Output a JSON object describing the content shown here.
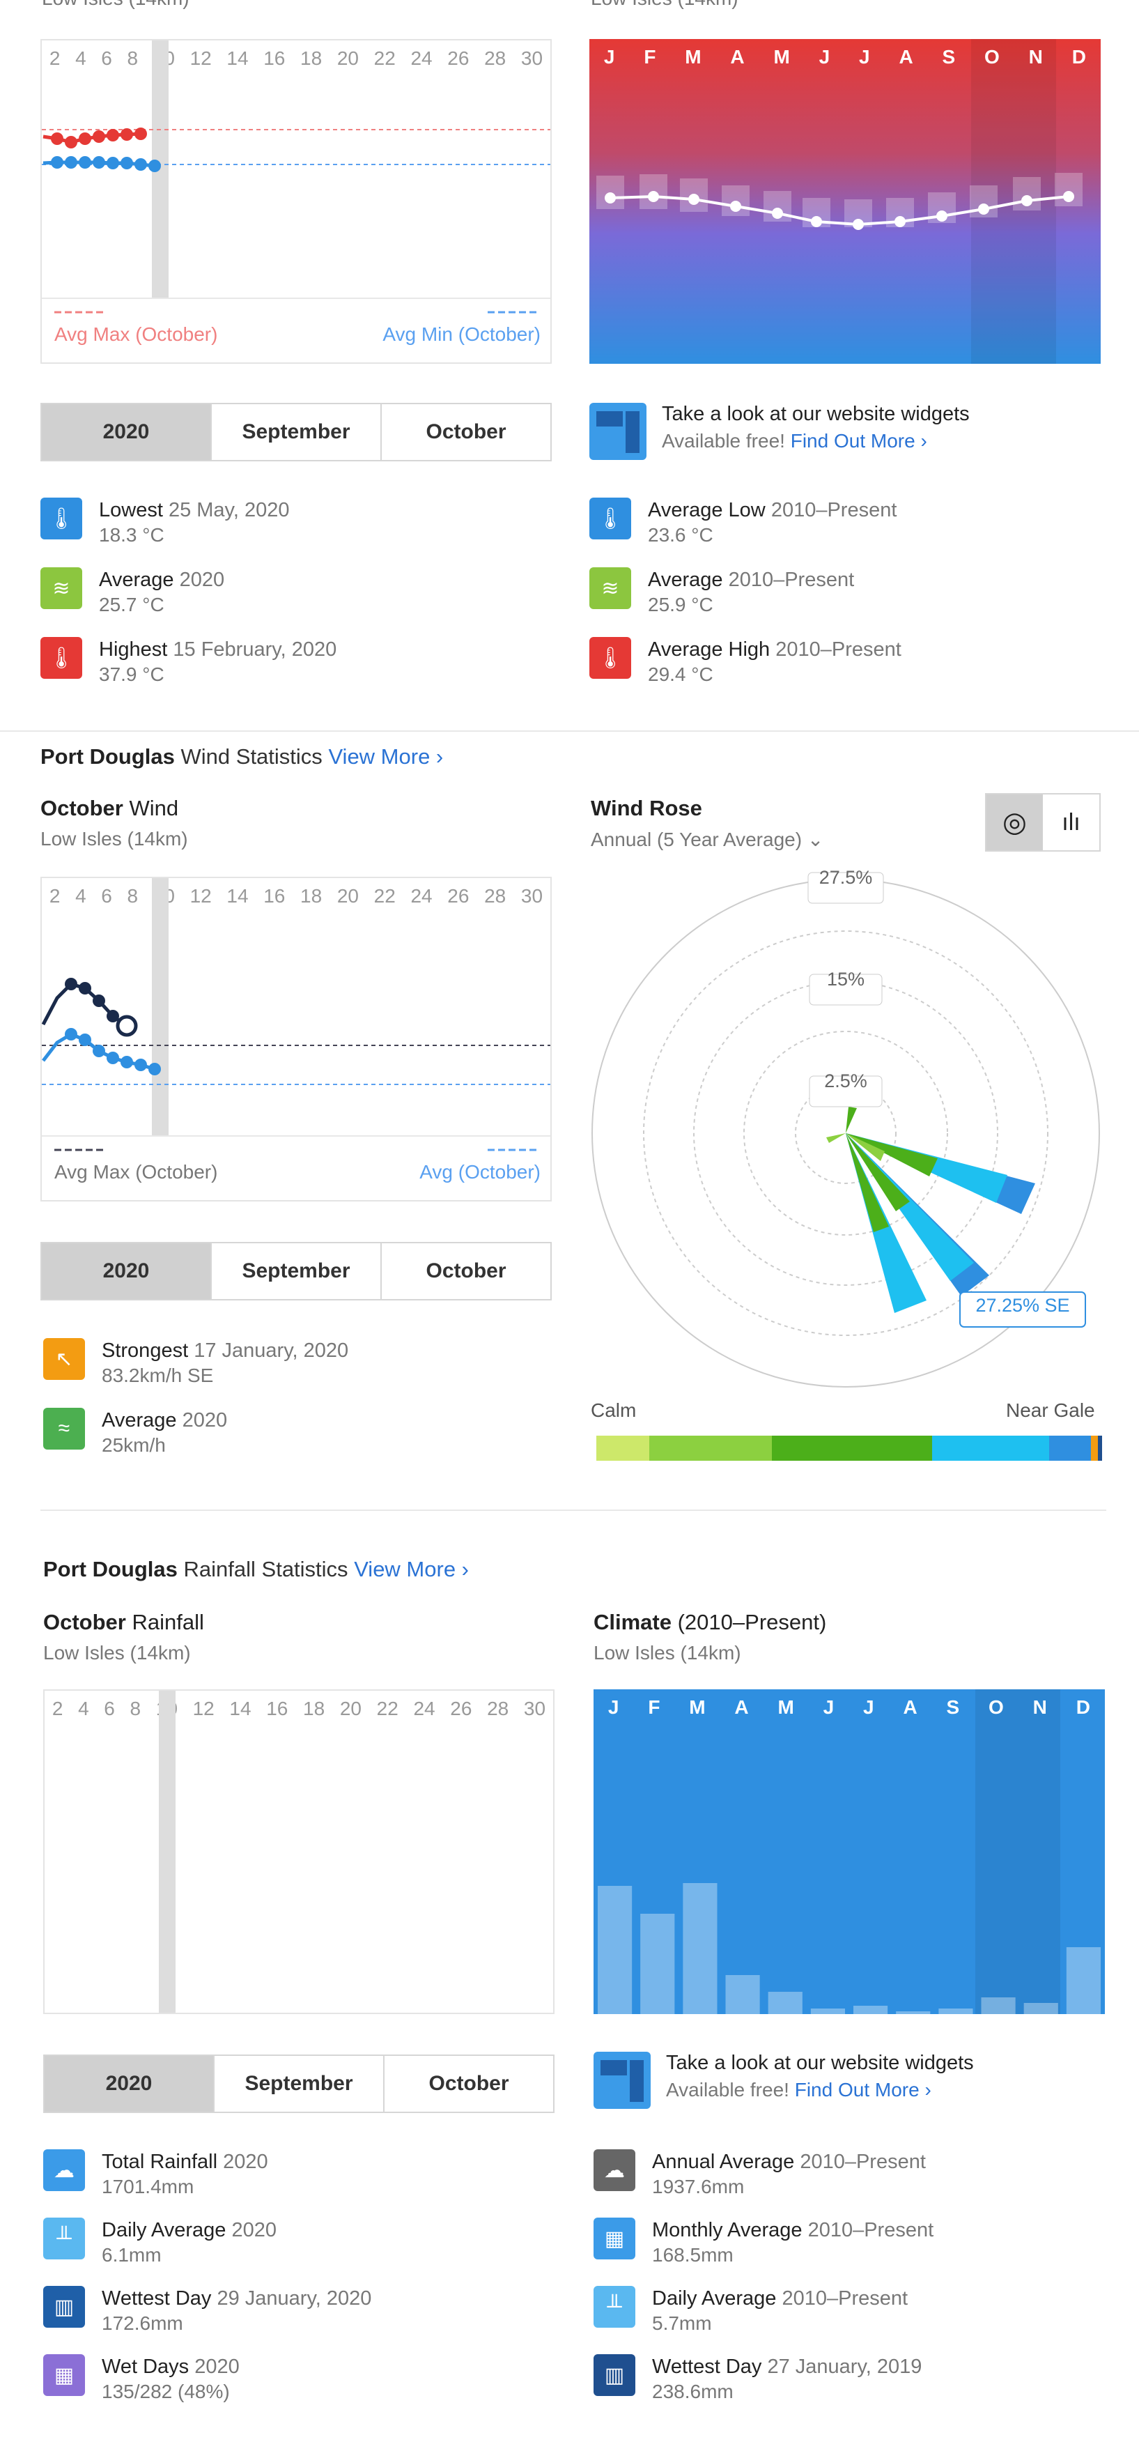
{
  "temperature": {
    "header_left": "Low Isles (14km)",
    "header_right": "Low Isles (14km)",
    "days": [
      "2",
      "4",
      "6",
      "8",
      "10",
      "12",
      "14",
      "16",
      "18",
      "20",
      "22",
      "24",
      "26",
      "28",
      "30"
    ],
    "current_day": "8",
    "legend_left": "Avg Max (October)",
    "legend_right": "Avg Min (October)",
    "months": [
      "J",
      "F",
      "M",
      "A",
      "M",
      "J",
      "J",
      "A",
      "S",
      "O",
      "N",
      "D"
    ],
    "tabs": [
      "2020",
      "September",
      "October"
    ],
    "widget_title": "Take a look at our website widgets",
    "widget_sub": "Available free!",
    "widget_link": "Find Out More ›",
    "stats_left": [
      {
        "label": "Lowest",
        "date": "25 May, 2020",
        "value": "18.3 °C",
        "color": "#2f8fe0",
        "icon": "thermometer-icon",
        "glyph": "🌡"
      },
      {
        "label": "Average",
        "date": "2020",
        "value": "25.7 °C",
        "color": "#8cc63f",
        "icon": "chart-icon",
        "glyph": "≋"
      },
      {
        "label": "Highest",
        "date": "15 February, 2020",
        "value": "37.9 °C",
        "color": "#e53935",
        "icon": "thermometer-icon",
        "glyph": "🌡"
      }
    ],
    "stats_right": [
      {
        "label": "Average Low",
        "date": "2010–Present",
        "value": "23.6 °C",
        "color": "#2f8fe0",
        "icon": "thermometer-icon",
        "glyph": "🌡"
      },
      {
        "label": "Average",
        "date": "2010–Present",
        "value": "25.9 °C",
        "color": "#8cc63f",
        "icon": "chart-icon",
        "glyph": "≋"
      },
      {
        "label": "Average High",
        "date": "2010–Present",
        "value": "29.4 °C",
        "color": "#e53935",
        "icon": "thermometer-icon",
        "glyph": "🌡"
      }
    ]
  },
  "wind": {
    "section_bold": "Port Douglas",
    "section_rest": "Wind Statistics",
    "view_more": "View More ›",
    "left_title_bold": "October",
    "left_title_rest": "Wind",
    "left_sub": "Low Isles (14km)",
    "legend_left": "Avg Max (October)",
    "legend_right": "Avg (October)",
    "tabs": [
      "2020",
      "September",
      "October"
    ],
    "rose_title": "Wind Rose",
    "rose_sub": "Annual (5 Year Average) ⌄",
    "rose_rings": [
      "27.5%",
      "15%",
      "2.5%"
    ],
    "rose_callout": "27.25% SE",
    "scale_left": "Calm",
    "scale_right": "Near Gale",
    "stats": [
      {
        "label": "Strongest",
        "date": "17 January, 2020",
        "value": "83.2km/h SE",
        "color": "#f39c12",
        "icon": "arrow-icon",
        "glyph": "↖"
      },
      {
        "label": "Average",
        "date": "2020",
        "value": "25km/h",
        "color": "#4caf50",
        "icon": "wind-icon",
        "glyph": "≈"
      }
    ]
  },
  "rainfall": {
    "section_bold": "Port Douglas",
    "section_rest": "Rainfall Statistics",
    "view_more": "View More ›",
    "left_title_bold": "October",
    "left_title_rest": "Rainfall",
    "left_sub": "Low Isles (14km)",
    "right_title_bold": "Climate",
    "right_title_rest": "(2010–Present)",
    "right_sub": "Low Isles (14km)",
    "tabs": [
      "2020",
      "September",
      "October"
    ],
    "widget_title": "Take a look at our website widgets",
    "widget_sub": "Available free!",
    "widget_link": "Find Out More ›",
    "climate_bars": [
      0.46,
      0.36,
      0.47,
      0.14,
      0.08,
      0.02,
      0.03,
      0.01,
      0.02,
      0.06,
      0.04,
      0.24
    ],
    "stats_left": [
      {
        "label": "Total Rainfall",
        "date": "2020",
        "value": "1701.4mm",
        "color": "#3b9be8",
        "icon": "rain-icon",
        "glyph": "☁"
      },
      {
        "label": "Daily Average",
        "date": "2020",
        "value": "6.1mm",
        "color": "#5ab8f0",
        "icon": "gauge-icon",
        "glyph": "╨"
      },
      {
        "label": "Wettest Day",
        "date": "29 January, 2020",
        "value": "172.6mm",
        "color": "#1f5fa8",
        "icon": "gauge-icon",
        "glyph": "▥"
      },
      {
        "label": "Wet Days",
        "date": "2020",
        "value": "135/282 (48%)",
        "color": "#8b6fd6",
        "icon": "calendar-icon",
        "glyph": "▦"
      }
    ],
    "stats_right": [
      {
        "label": "Annual Average",
        "date": "2010–Present",
        "value": "1937.6mm",
        "color": "#666",
        "icon": "rain-icon",
        "glyph": "☁"
      },
      {
        "label": "Monthly Average",
        "date": "2010–Present",
        "value": "168.5mm",
        "color": "#3b9be8",
        "icon": "calendar-icon",
        "glyph": "▦"
      },
      {
        "label": "Daily Average",
        "date": "2010–Present",
        "value": "5.7mm",
        "color": "#5ab8f0",
        "icon": "gauge-icon",
        "glyph": "╨"
      },
      {
        "label": "Wettest Day",
        "date": "27 January, 2019",
        "value": "238.6mm",
        "color": "#1f4f8f",
        "icon": "gauge-icon",
        "glyph": "▥"
      }
    ]
  }
}
